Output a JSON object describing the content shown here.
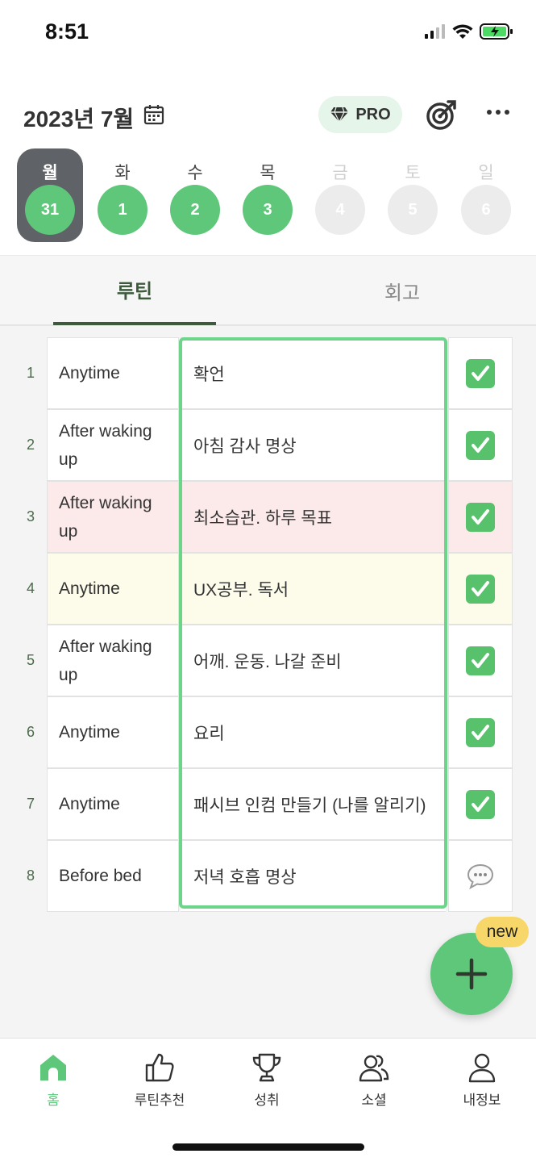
{
  "status": {
    "time": "8:51"
  },
  "header": {
    "month_title": "2023년 7월",
    "pro_label": "PRO"
  },
  "week": [
    {
      "label": "월",
      "day": "31",
      "state": "selected"
    },
    {
      "label": "화",
      "day": "1",
      "state": "done"
    },
    {
      "label": "수",
      "day": "2",
      "state": "done"
    },
    {
      "label": "목",
      "day": "3",
      "state": "done"
    },
    {
      "label": "금",
      "day": "4",
      "state": "future"
    },
    {
      "label": "토",
      "day": "5",
      "state": "future"
    },
    {
      "label": "일",
      "day": "6",
      "state": "future"
    }
  ],
  "tabs": {
    "routine": "루틴",
    "review": "회고"
  },
  "routines": [
    {
      "num": "1",
      "when": "Anytime",
      "task": "확언",
      "status": "checked",
      "highlight": "none"
    },
    {
      "num": "2",
      "when": "After waking up",
      "task": "아침 감사 명상",
      "status": "checked",
      "highlight": "none"
    },
    {
      "num": "3",
      "when": "After waking up",
      "task": "최소습관. 하루 목표",
      "status": "checked",
      "highlight": "pink"
    },
    {
      "num": "4",
      "when": "Anytime",
      "task": "UX공부. 독서",
      "status": "checked",
      "highlight": "yellow"
    },
    {
      "num": "5",
      "when": "After waking up",
      "task": "어깨. 운동. 나갈 준비",
      "status": "checked",
      "highlight": "none"
    },
    {
      "num": "6",
      "when": "Anytime",
      "task": "요리",
      "status": "checked",
      "highlight": "none"
    },
    {
      "num": "7",
      "when": "Anytime",
      "task": "패시브 인컴 만들기 (나를 알리기)",
      "status": "checked",
      "highlight": "none"
    },
    {
      "num": "8",
      "when": "Before bed",
      "task": "저녁 호흡 명상",
      "status": "comment",
      "highlight": "none"
    }
  ],
  "fab": {
    "badge": "new"
  },
  "nav": {
    "home": "홈",
    "recommend": "루틴추천",
    "achievement": "성취",
    "social": "소셜",
    "profile": "내정보"
  },
  "colors": {
    "accent": "#5ec77a",
    "selected_day": "#5f6367",
    "pink_row": "#fce9e9",
    "yellow_row": "#fdfcea",
    "new_badge": "#f7d76a"
  }
}
